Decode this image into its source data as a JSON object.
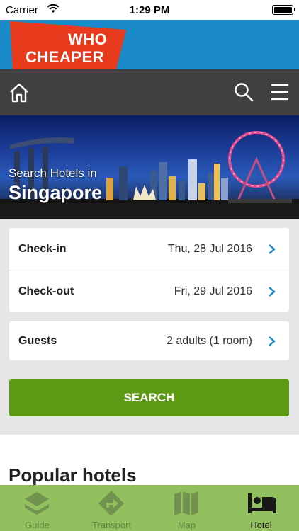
{
  "status_bar": {
    "carrier": "Carrier",
    "time": "1:29 PM",
    "wifi_icon": "wifi-icon",
    "battery_icon": "battery-icon"
  },
  "logo": {
    "line1": "WHO",
    "line2": "CHEAPER"
  },
  "nav": {
    "home_icon": "home-icon",
    "search_icon": "search-icon",
    "menu_icon": "menu-icon"
  },
  "hero": {
    "subtitle": "Search Hotels in",
    "city": "Singapore"
  },
  "form": {
    "checkin": {
      "label": "Check-in",
      "value": "Thu, 28 Jul 2016"
    },
    "checkout": {
      "label": "Check-out",
      "value": "Fri, 29 Jul 2016"
    },
    "guests": {
      "label": "Guests",
      "value": "2 adults (1 room)"
    },
    "search_label": "SEARCH"
  },
  "popular": {
    "heading": "Popular hotels"
  },
  "tabs": [
    {
      "label": "Guide",
      "icon": "layers-icon",
      "active": false
    },
    {
      "label": "Transport",
      "icon": "directions-icon",
      "active": false
    },
    {
      "label": "Map",
      "icon": "map-icon",
      "active": false
    },
    {
      "label": "Hotel",
      "icon": "bed-icon",
      "active": true
    }
  ],
  "colors": {
    "brand_blue": "#1a8ac8",
    "logo_red": "#e83a1c",
    "nav_dark": "#404040",
    "accent_green": "#5d9a13",
    "tab_green": "#8fbe5a",
    "chevron_blue": "#1a8ac8"
  }
}
